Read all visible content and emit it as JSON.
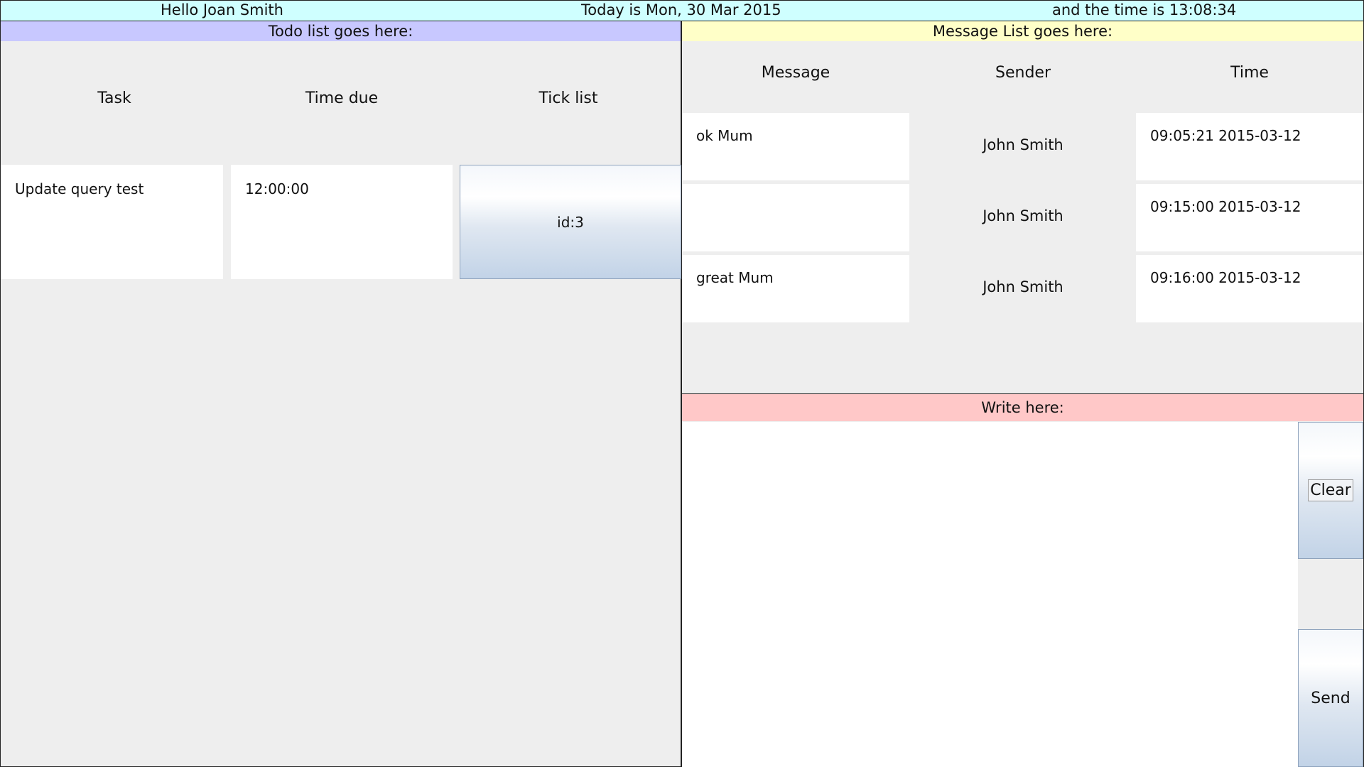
{
  "header": {
    "greeting": "Hello Joan Smith",
    "date": "Today is Mon, 30 Mar 2015",
    "time": "and the time is 13:08:34"
  },
  "todo": {
    "title": "Todo list goes here:",
    "columns": [
      "Task",
      "Time due",
      "Tick list"
    ],
    "rows": [
      {
        "task": "Update query test",
        "time_due": "12:00:00",
        "tick_label": "id:3"
      }
    ]
  },
  "messages": {
    "title": "Message List goes here:",
    "columns": [
      "Message",
      "Sender",
      "Time"
    ],
    "rows": [
      {
        "message": "ok Mum",
        "sender": "John Smith",
        "time": "09:05:21 2015-03-12"
      },
      {
        "message": "",
        "sender": "John Smith",
        "time": "09:15:00 2015-03-12"
      },
      {
        "message": "great Mum",
        "sender": "John Smith",
        "time": "09:16:00 2015-03-12"
      }
    ]
  },
  "compose": {
    "title": "Write here:",
    "text": "",
    "clear_label": "Clear",
    "send_label": "Send"
  },
  "colors": {
    "header_bg": "#cfffff",
    "todo_header_bg": "#c8c8ff",
    "messages_header_bg": "#ffffc8",
    "write_header_bg": "#ffc8c8",
    "panel_bg": "#eeeeee"
  }
}
